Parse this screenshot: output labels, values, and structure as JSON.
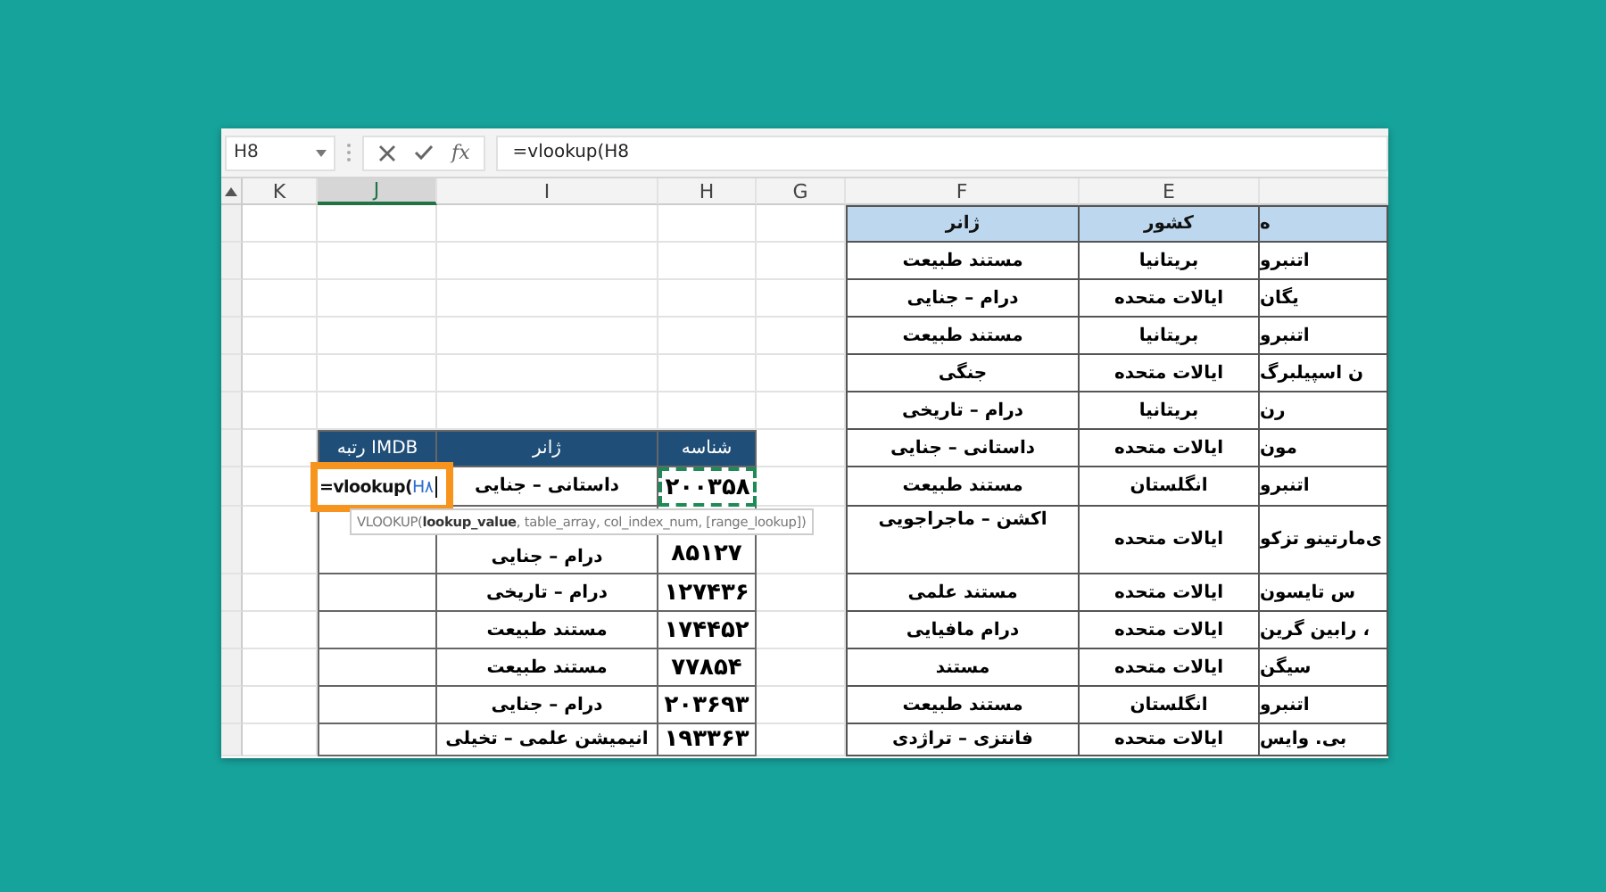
{
  "formula_bar": {
    "name_box": "H8",
    "function_button": "fx",
    "formula": "=vlookup(H8"
  },
  "columns": [
    {
      "label": "E",
      "selected": false
    },
    {
      "label": "F",
      "selected": false
    },
    {
      "label": "G",
      "selected": false
    },
    {
      "label": "H",
      "selected": false
    },
    {
      "label": "I",
      "selected": false
    },
    {
      "label": "J",
      "selected": true
    },
    {
      "label": "K",
      "selected": false
    }
  ],
  "left_table": {
    "columns": [
      "شناسه",
      "ژانر",
      "رتبه IMDB"
    ],
    "active_cell": {
      "prefix": "=vlookup(",
      "reference": "H۸"
    },
    "tooltip": "VLOOKUP(**lookup_value**, table_array, col_index_num, [range_lookup])",
    "rows": [
      {
        "genre": "داستانی – جنایی",
        "id": "۲۰۰۳۵۸",
        "referenced": true
      },
      {
        "genre": "درام – جنایی",
        "id": "۸۵۱۲۷",
        "referenced": false
      },
      {
        "genre": "درام – تاریخی",
        "id": "۱۲۷۴۳۶",
        "referenced": false
      },
      {
        "genre": "مستند طبیعت",
        "id": "۱۷۴۴۵۲",
        "referenced": false
      },
      {
        "genre": "مستند طبیعت",
        "id": "۷۷۸۵۴",
        "referenced": false
      },
      {
        "genre": "درام – جنایی",
        "id": "۲۰۳۶۹۳",
        "referenced": false
      },
      {
        "genre": "انیمیشن علمی – تخیلی",
        "id": "۱۹۳۳۶۳",
        "referenced": false
      }
    ]
  },
  "right_table": {
    "columns": [
      "ه",
      "کشور",
      "ژانر"
    ],
    "rows": [
      {
        "genre": "مستند طبیعت",
        "country": "بریتانیا",
        "column_3": "اتنبرو"
      },
      {
        "genre": "درام – جنایی",
        "country": "ایالات متحده",
        "column_3": "یگان"
      },
      {
        "genre": "مستند طبیعت",
        "country": "بریتانیا",
        "column_3": "اتنبرو"
      },
      {
        "genre": "جنگی",
        "country": "ایالات متحده",
        "column_3": "ن اسپیلبرگ"
      },
      {
        "genre": "درام – تاریخی",
        "country": "بریتانیا",
        "column_3": "رن"
      },
      {
        "genre": "داستانی – جنایی",
        "country": "ایالات متحده",
        "column_3": "مون"
      },
      {
        "genre": "مستند طبیعت",
        "country": "انگلستان",
        "column_3": "اتنبرو"
      },
      {
        "genre": "اکشن – ماجراجویی",
        "country": "ایالات متحده",
        "column_3": "ی‌مارتینو تزکو"
      },
      {
        "genre": "مستند علمی",
        "country": "ایالات متحده",
        "column_3": "س تایسون"
      },
      {
        "genre": "درام مافیایی",
        "country": "ایالات متحده",
        "column_3": "، رابین گرین"
      },
      {
        "genre": "مستند",
        "country": "ایالات متحده",
        "column_3": "سیگن"
      },
      {
        "genre": "مستند طبیعت",
        "country": "انگلستان",
        "column_3": "اتنبرو"
      },
      {
        "genre": "فانتزی – تراژدی",
        "country": "ایالات متحده",
        "column_3": "بی. وایس"
      }
    ]
  }
}
